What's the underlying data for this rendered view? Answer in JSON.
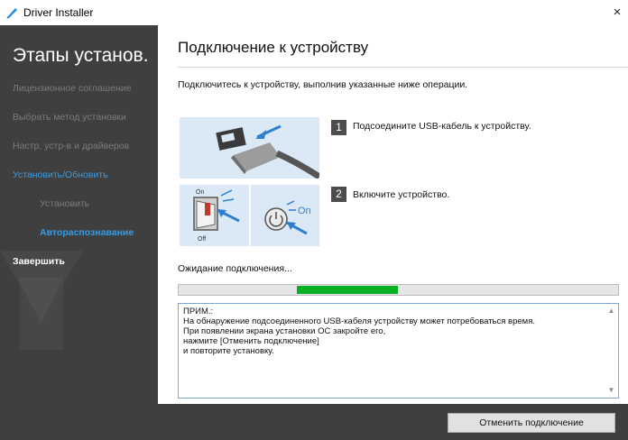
{
  "window": {
    "title": "Driver Installer",
    "close_symbol": "×",
    "icon": "driver-installer-icon"
  },
  "sidebar": {
    "title": "Этапы установ.",
    "items": [
      {
        "label": "Лицензионное соглашение",
        "state": "done"
      },
      {
        "label": "Выбрать метод установки",
        "state": "done"
      },
      {
        "label": "Настр. устр-в и драйверов",
        "state": "done"
      },
      {
        "label": "Установить/Обновить",
        "state": "active"
      },
      {
        "label": "Установить",
        "state": "sub-done"
      },
      {
        "label": "Автораспознавание",
        "state": "sub-active"
      },
      {
        "label": "Завершить",
        "state": "pending"
      }
    ]
  },
  "main": {
    "heading": "Подключение к устройству",
    "intro": "Подключитесь к устройству, выполнив указанные ниже операции.",
    "steps": [
      {
        "number": "1",
        "text": "Подсоедините USB-кабель к устройству."
      },
      {
        "number": "2",
        "text": "Включите устройство."
      }
    ],
    "illustration": {
      "switch_on_label": "On",
      "switch_off_label": "Off",
      "power_on_label": "On"
    },
    "waiting_text": "Ожидание подключения...",
    "progress": {
      "fill_start": 0.27,
      "fill_end": 0.5,
      "indeterminate": true
    },
    "note": {
      "text": "ПРИМ.:\nНа обнаружение подсоединенного USB-кабеля устройству может потребоваться время.\nПри появлении экрана установки ОС закройте его,\nнажмите [Отменить подключение]\nи повторите установку."
    }
  },
  "footer": {
    "cancel_button": "Отменить подключение"
  },
  "colors": {
    "sidebar_bg": "#3f3f3f",
    "accent_blue": "#3c9be0",
    "progress_green": "#06b025",
    "illustration_bg": "#dbe9f6"
  }
}
